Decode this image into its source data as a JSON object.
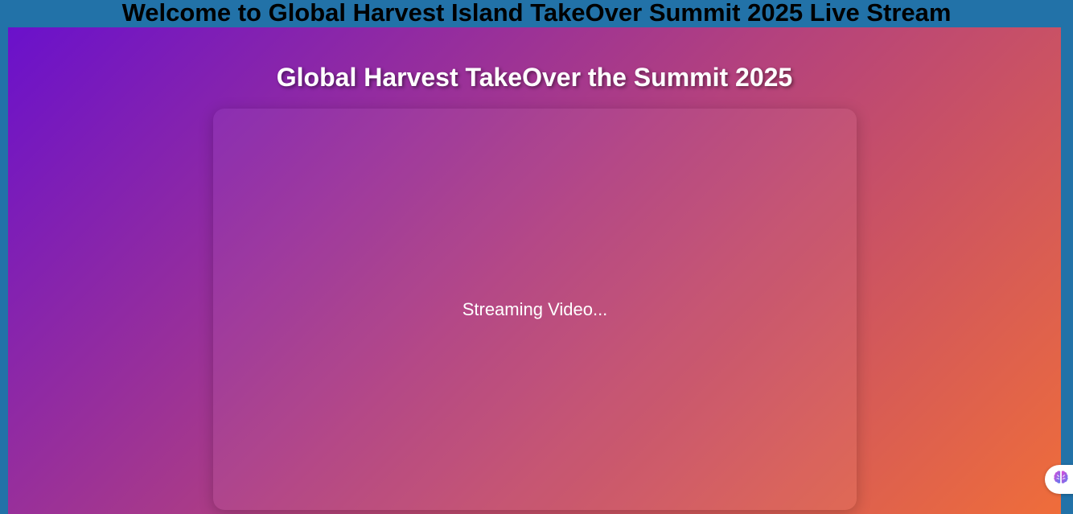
{
  "banner": {
    "title": "Welcome to Global Harvest Island TakeOver Summit 2025 Live Stream"
  },
  "stream": {
    "heading": "Global Harvest TakeOver the Summit 2025",
    "status_text": "Streaming Video..."
  },
  "assistant_widget": {
    "icon": "brain-icon"
  },
  "colors": {
    "page_background": "#2272a8",
    "gradient_start": "#6a11cb",
    "gradient_end": "#ef6d3a",
    "heading_text": "#ffffff",
    "banner_text": "#000000"
  }
}
